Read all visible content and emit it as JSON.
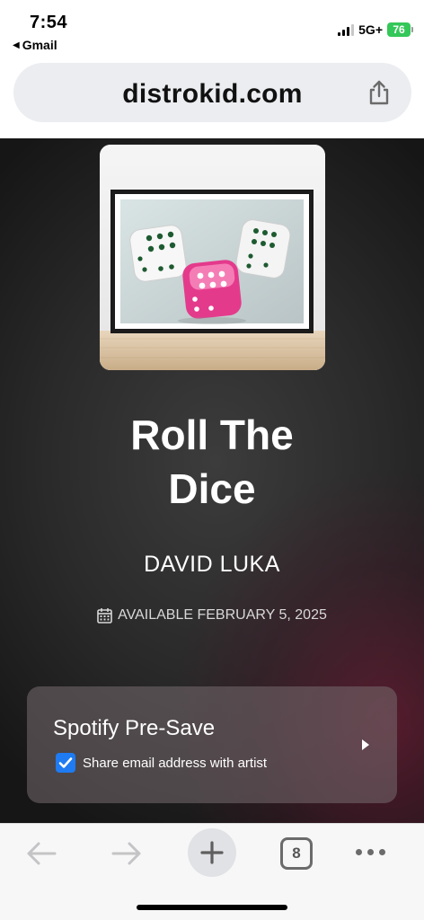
{
  "status_bar": {
    "time": "7:54",
    "back_app": "Gmail",
    "network": "5G+",
    "battery": "76"
  },
  "browser": {
    "url": "distrokid.com",
    "tab_count": "8"
  },
  "release": {
    "title_line1": "Roll The",
    "title_line2": "Dice",
    "artist": "DAVID LUKA",
    "availability": "AVAILABLE FEBRUARY 5, 2025"
  },
  "presave": {
    "title": "Spotify Pre-Save",
    "checkbox_label": "Share email address with artist",
    "checkbox_checked": true
  },
  "colors": {
    "accent_blue": "#1e7bf2",
    "battery_green": "#34c759",
    "background_dark": "#2a2a2a",
    "background_tint": "#691c34"
  }
}
